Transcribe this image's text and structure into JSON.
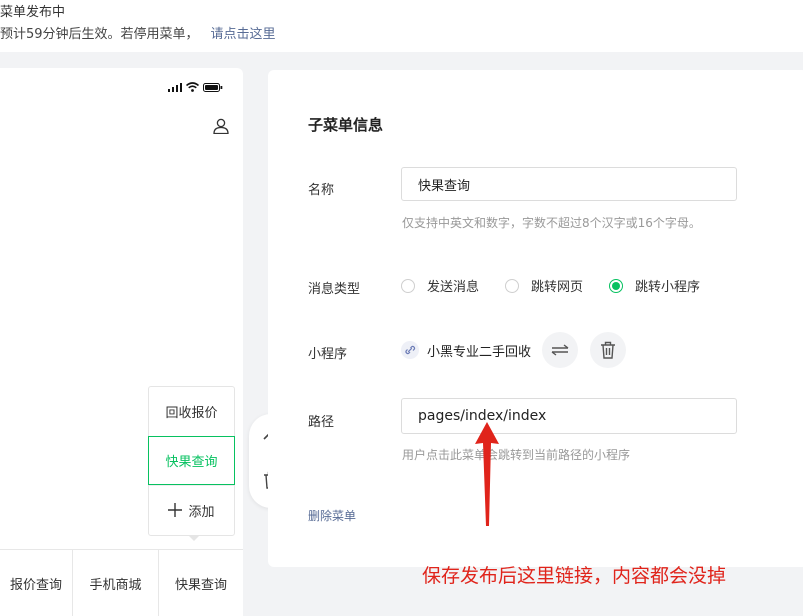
{
  "notice": {
    "line1": "菜单发布中",
    "line2": "预计59分钟后生效。若停用菜单，",
    "link": "请点击这里"
  },
  "phone": {
    "status_icons": [
      "signal-icon",
      "wifi-icon",
      "battery-icon"
    ],
    "user_icon": "user-icon",
    "submenu": {
      "items": [
        "回收报价",
        "快果查询"
      ],
      "add_label": "添加"
    },
    "bottom_tabs": [
      "报价查询",
      "手机商城",
      "快果查询"
    ]
  },
  "float_tools": {
    "icons": [
      "arrow-up-icon",
      "trash-icon"
    ]
  },
  "panel": {
    "title": "子菜单信息",
    "name_label": "名称",
    "name_value": "快果查询",
    "name_hint": "仅支持中英文和数字，字数不超过8个汉字或16个字母。",
    "type_label": "消息类型",
    "type_options": [
      "发送消息",
      "跳转网页",
      "跳转小程序"
    ],
    "type_selected": "跳转小程序",
    "miniprogram_label": "小程序",
    "miniprogram_name": "小黑专业二手回收",
    "path_label": "路径",
    "path_value": "pages/index/index",
    "path_hint": "用户点击此菜单会跳转到当前路径的小程序",
    "delete_label": "删除菜单"
  },
  "annotation": {
    "text": "保存发布后这里链接，内容都会没掉",
    "color": "#e0241b"
  },
  "colors": {
    "accent": "#07c160",
    "link": "#576b95"
  }
}
